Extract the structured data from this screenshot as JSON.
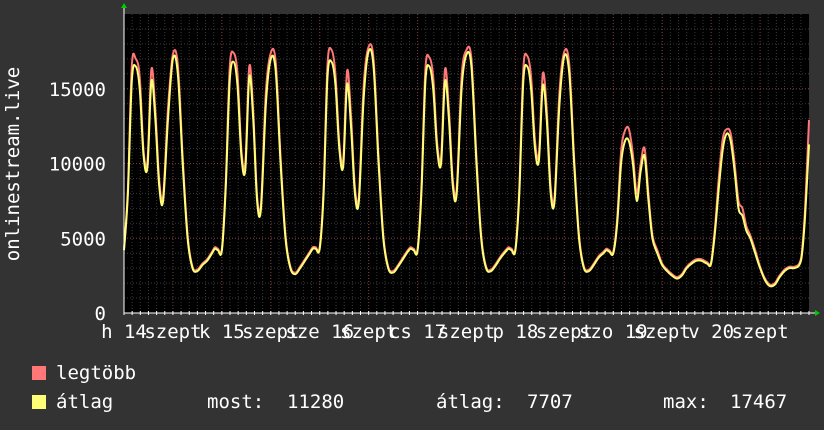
{
  "chart_data": {
    "type": "line",
    "ylabel": "onlinestream.live",
    "ylim": [
      0,
      20000
    ],
    "yticks": [
      0,
      5000,
      10000,
      15000
    ],
    "ytick_labels": [
      "0",
      "5000",
      "10000",
      "15000"
    ],
    "xticks": [
      {
        "label": "h 14",
        "day": 0
      },
      {
        "label": "szept",
        "day": 0.5
      },
      {
        "label": "k 15",
        "day": 1
      },
      {
        "label": "szept",
        "day": 1.5
      },
      {
        "label": "sze 16",
        "day": 2
      },
      {
        "label": "szept",
        "day": 2.5
      },
      {
        "label": "cs 17",
        "day": 3
      },
      {
        "label": "szept",
        "day": 3.5
      },
      {
        "label": "p 18",
        "day": 4
      },
      {
        "label": "szept",
        "day": 4.5
      },
      {
        "label": "szo 19",
        "day": 5
      },
      {
        "label": "szept",
        "day": 5.5
      },
      {
        "label": "v 20",
        "day": 6
      },
      {
        "label": "szept",
        "day": 6.5
      }
    ],
    "grid": true,
    "series": [
      {
        "name": "legtöbb",
        "color": "#ff7777",
        "values": []
      },
      {
        "name": "átlag",
        "color": "#ffff77",
        "values": []
      }
    ],
    "stats": {
      "now_label": "most:",
      "now_value": "11280",
      "avg_label": "átlag:",
      "avg_value": "7707",
      "max_label": "max:",
      "max_value": "17467"
    },
    "day_profile": {
      "x": [
        0,
        0.04,
        0.08,
        0.12,
        0.16,
        0.2,
        0.24,
        0.28,
        0.32,
        0.36,
        0.4,
        0.45,
        0.5,
        0.55,
        0.6,
        0.65,
        0.7,
        0.75,
        0.8,
        0.85,
        0.9,
        0.93,
        0.96,
        1
      ],
      "days": [
        {
          "avg": [
            4200,
            8000,
            15500,
            16500,
            15000,
            10500,
            9800,
            15500,
            13000,
            8500,
            7500,
            13000,
            17000,
            16000,
            10000,
            5000,
            3000,
            2800,
            3200,
            3500,
            4000,
            4300,
            4200,
            4200
          ],
          "max": [
            4300,
            8300,
            16500,
            17000,
            15800,
            10800,
            10200,
            16300,
            13600,
            8900,
            7800,
            13700,
            17300,
            16600,
            10400,
            5200,
            3100,
            2900,
            3300,
            3600,
            4100,
            4400,
            4300,
            4300
          ]
        },
        {
          "avg": [
            4200,
            8500,
            15500,
            16800,
            15200,
            10500,
            9600,
            15800,
            13000,
            7500,
            7000,
            14000,
            17000,
            16200,
            10000,
            5000,
            3000,
            2600,
            3000,
            3500,
            4000,
            4300,
            4300,
            4300
          ],
          "max": [
            4300,
            8800,
            16400,
            17400,
            16000,
            10900,
            10000,
            16500,
            13500,
            7800,
            7300,
            14800,
            17400,
            16800,
            10400,
            5200,
            3100,
            2700,
            3100,
            3600,
            4100,
            4400,
            4400,
            4400
          ],
          "note": ""
        },
        {
          "avg": [
            4200,
            8000,
            15800,
            16800,
            15300,
            11000,
            9800,
            15300,
            12500,
            8000,
            7500,
            14500,
            17500,
            16500,
            10200,
            5000,
            3000,
            2700,
            3100,
            3600,
            4100,
            4300,
            4200,
            4200
          ],
          "max": [
            4300,
            8300,
            16600,
            17600,
            16000,
            11400,
            10200,
            16200,
            13200,
            8400,
            7800,
            15300,
            17800,
            17000,
            10600,
            5200,
            3100,
            2800,
            3200,
            3700,
            4200,
            4400,
            4300,
            4300
          ]
        },
        {
          "avg": [
            4200,
            8200,
            15500,
            16500,
            15000,
            11000,
            10000,
            15500,
            13000,
            8500,
            8000,
            15000,
            17300,
            16500,
            10200,
            5000,
            3000,
            2800,
            3200,
            3700,
            4100,
            4300,
            4200,
            4200
          ],
          "max": [
            4300,
            8500,
            16300,
            17100,
            15800,
            11400,
            10400,
            16300,
            13600,
            8900,
            8300,
            15800,
            17600,
            17000,
            10600,
            5200,
            3100,
            2900,
            3300,
            3800,
            4200,
            4400,
            4300,
            4300
          ]
        },
        {
          "avg": [
            4200,
            8000,
            15500,
            16500,
            15000,
            11000,
            10200,
            15200,
            13000,
            8000,
            7500,
            14000,
            17200,
            16000,
            10000,
            5000,
            3000,
            2800,
            3200,
            3700,
            4000,
            4200,
            4100,
            4000
          ],
          "max": [
            4300,
            8300,
            16300,
            17200,
            15800,
            11500,
            10600,
            16000,
            13600,
            8400,
            7800,
            14800,
            17500,
            16600,
            10400,
            5200,
            3100,
            2900,
            3300,
            3800,
            4100,
            4300,
            4200,
            4100
          ]
        },
        {
          "avg": [
            4000,
            6000,
            10000,
            11500,
            11500,
            10000,
            7500,
            9500,
            10500,
            7500,
            5000,
            4000,
            3200,
            2800,
            2500,
            2300,
            2500,
            3000,
            3300,
            3500,
            3500,
            3400,
            3300,
            3300
          ],
          "max": [
            4100,
            6300,
            10800,
            12200,
            12300,
            10600,
            8000,
            10000,
            11000,
            7900,
            5200,
            4200,
            3300,
            2900,
            2600,
            2400,
            2600,
            3100,
            3400,
            3600,
            3600,
            3500,
            3400,
            3400
          ]
        },
        {
          "avg": [
            3300,
            5500,
            8500,
            11000,
            12000,
            11500,
            9500,
            7000,
            6500,
            5500,
            5000,
            4000,
            3000,
            2200,
            1800,
            1900,
            2400,
            2800,
            3000,
            3000,
            3200,
            4000,
            6500,
            11280
          ],
          "max": [
            3400,
            5800,
            9200,
            11700,
            12300,
            12000,
            10000,
            7500,
            7000,
            5800,
            5200,
            4200,
            3100,
            2300,
            1900,
            2000,
            2500,
            2900,
            3100,
            3100,
            3300,
            4200,
            7000,
            12900
          ]
        }
      ]
    }
  },
  "legend": {
    "max_label": "legtöbb",
    "avg_label": "átlag",
    "max_color": "#ff7777",
    "avg_color": "#ffff77"
  }
}
